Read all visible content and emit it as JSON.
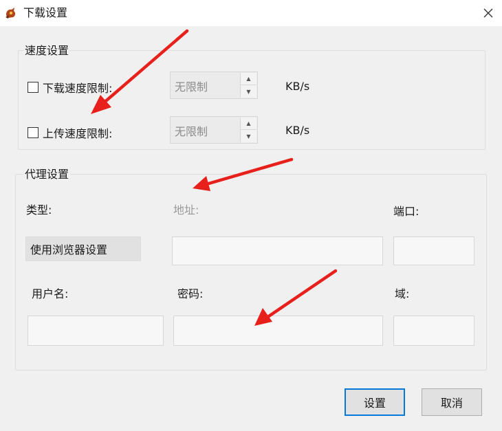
{
  "window": {
    "title": "下载设置",
    "icon": "app-logo-icon",
    "close_icon": "close-icon"
  },
  "speed": {
    "legend": "速度设置",
    "download_label": "下载速度限制:",
    "download_value": "无限制",
    "upload_label": "上传速度限制:",
    "upload_value": "无限制",
    "unit": "KB/s",
    "download_checked": false,
    "upload_checked": false
  },
  "proxy": {
    "legend": "代理设置",
    "type_label": "类型:",
    "type_value": "使用浏览器设置",
    "address_label": "地址:",
    "port_label": "端口:",
    "username_label": "用户名:",
    "password_label": "密码:",
    "domain_label": "域:"
  },
  "buttons": {
    "ok": "设置",
    "cancel": "取消"
  },
  "colors": {
    "accent": "#0078d7",
    "annotation_arrow": "#e8201b",
    "panel": "#f0f0f0"
  }
}
